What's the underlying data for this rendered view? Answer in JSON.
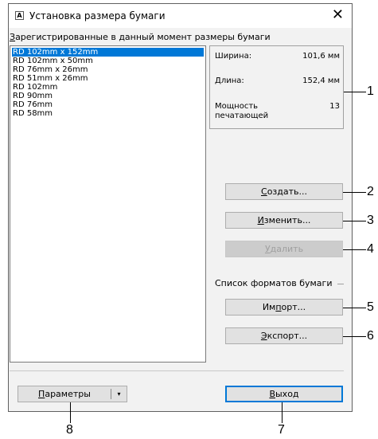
{
  "window": {
    "title": "Установка размера бумаги",
    "close_glyph": "✕"
  },
  "registered_label": "Зарегистрированные в данный момент размеры бумаги",
  "registered_label_underline": "З",
  "registered_label_rest": "арегистрированные в данный момент размеры бумаги",
  "paper_sizes": [
    "RD 102mm x 152mm",
    "RD 102mm x 50mm",
    "RD 76mm x 26mm",
    "RD 51mm x 26mm",
    "RD 102mm",
    "RD 90mm",
    "RD 76mm",
    "RD 58mm"
  ],
  "selected_index": 0,
  "info": {
    "width_label": "Ширина:",
    "width_value": "101,6 мм",
    "length_label": "Длина:",
    "length_value": "152,4 мм",
    "power_label_line1": "Мощность",
    "power_label_line2": "печатающей",
    "power_value": "13"
  },
  "buttons": {
    "create": {
      "u": "С",
      "rest": "оздать..."
    },
    "edit": {
      "u": "И",
      "rest": "зменить..."
    },
    "delete": {
      "u": "У",
      "rest": "далить"
    },
    "import": {
      "pre": "Им",
      "u": "п",
      "rest": "орт..."
    },
    "export": {
      "u": "Э",
      "rest": "кспорт..."
    },
    "exit": {
      "u": "В",
      "rest": "ыход"
    },
    "params": {
      "u": "П",
      "rest": "араметры"
    }
  },
  "format_list_label": "Список форматов бумаги",
  "params_arrow": "▾",
  "callouts": [
    "1",
    "2",
    "3",
    "4",
    "5",
    "6",
    "7",
    "8"
  ]
}
